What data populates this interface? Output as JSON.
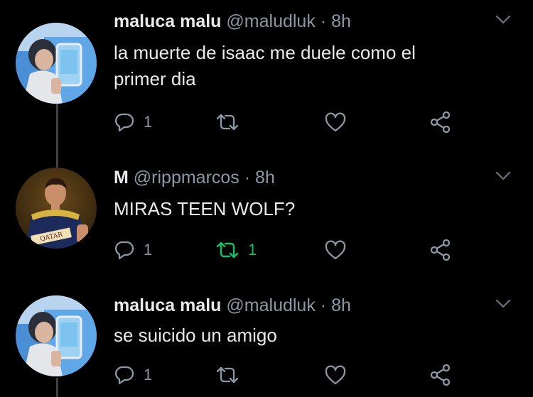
{
  "colors": {
    "background": "#000000",
    "text": "#e7e9ea",
    "muted": "#8b98a5",
    "retweet_active": "#17bf63",
    "thread_line": "#3e4144"
  },
  "tweets": [
    {
      "name": "maluca malu",
      "handle": "@maludluk",
      "separator": "·",
      "time": "8h",
      "text_lines": [
        "la muerte de isaac me duele como el",
        "primer dia"
      ],
      "avatar": "selfie-avatar",
      "reply_count": "1",
      "retweet_count": "",
      "retweeted": false
    },
    {
      "name": "M",
      "handle": "@rippmarcos",
      "separator": "·",
      "time": "8h",
      "text_lines": [
        "MIRAS TEEN WOLF?"
      ],
      "avatar": "footballer-avatar",
      "avatar_text": "QATAR",
      "reply_count": "1",
      "retweet_count": "1",
      "retweeted": true
    },
    {
      "name": "maluca malu",
      "handle": "@maludluk",
      "separator": "·",
      "time": "8h",
      "text_lines": [
        "se suicido un amigo"
      ],
      "avatar": "selfie-avatar",
      "reply_count": "1",
      "retweet_count": "",
      "retweeted": false
    }
  ],
  "icons": {
    "reply": "reply-icon",
    "retweet": "retweet-icon",
    "like": "heart-icon",
    "share": "share-icon",
    "more": "chevron-down-icon"
  }
}
